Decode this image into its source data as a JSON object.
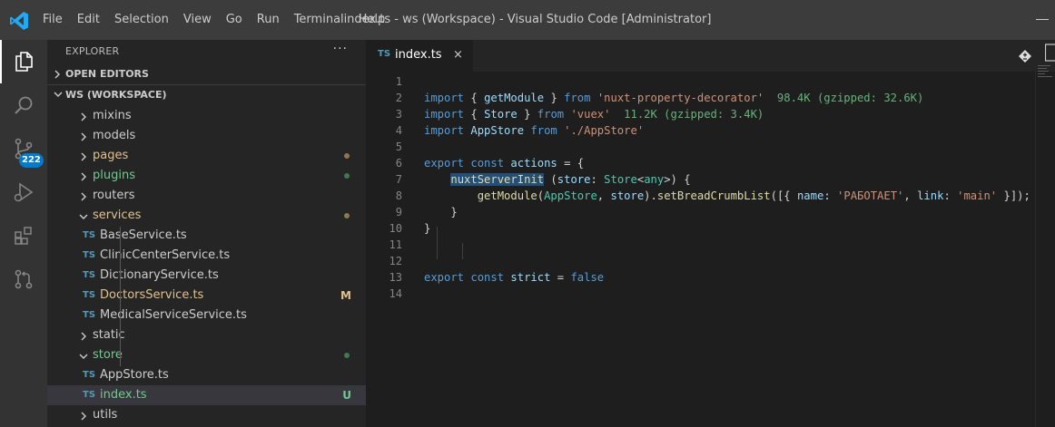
{
  "window": {
    "title": "index.ts - ws (Workspace) - Visual Studio Code [Administrator]",
    "menu": [
      "File",
      "Edit",
      "Selection",
      "View",
      "Go",
      "Run",
      "Terminal",
      "Help"
    ]
  },
  "activity_bar": {
    "items": [
      {
        "icon": "files-icon",
        "active": true
      },
      {
        "icon": "search-icon"
      },
      {
        "icon": "source-control-icon",
        "badge": "222"
      },
      {
        "icon": "run-debug-icon"
      },
      {
        "icon": "extensions-icon"
      },
      {
        "icon": "pull-requests-icon"
      }
    ]
  },
  "explorer": {
    "title": "EXPLORER",
    "more": "···",
    "sections": {
      "open_editors": "OPEN EDITORS",
      "workspace": "WS (WORKSPACE)"
    },
    "tree": [
      {
        "type": "folder",
        "label": "mixins",
        "color": "#cccccc"
      },
      {
        "type": "folder",
        "label": "models",
        "color": "#cccccc"
      },
      {
        "type": "folder",
        "label": "pages",
        "color": "#e2c08d",
        "dot": "#8a7850"
      },
      {
        "type": "folder",
        "label": "plugins",
        "color": "#73c991",
        "dot": "#3f7a4f"
      },
      {
        "type": "folder",
        "label": "routers",
        "color": "#cccccc"
      },
      {
        "type": "folder",
        "label": "services",
        "color": "#e2c08d",
        "dot": "#8a7850",
        "open": true
      },
      {
        "type": "file",
        "label": "BaseService.ts",
        "color": "#cccccc",
        "icon": "TS"
      },
      {
        "type": "file",
        "label": "ClinicCenterService.ts",
        "color": "#cccccc",
        "icon": "TS"
      },
      {
        "type": "file",
        "label": "DictionaryService.ts",
        "color": "#cccccc",
        "icon": "TS"
      },
      {
        "type": "file",
        "label": "DoctorsService.ts",
        "color": "#e2c08d",
        "icon": "TS",
        "status": "M"
      },
      {
        "type": "file",
        "label": "MedicalServiceService.ts",
        "color": "#cccccc",
        "icon": "TS"
      },
      {
        "type": "folder",
        "label": "static",
        "color": "#cccccc"
      },
      {
        "type": "folder",
        "label": "store",
        "color": "#73c991",
        "dot": "#3f7a4f",
        "open": true
      },
      {
        "type": "file",
        "label": "AppStore.ts",
        "color": "#cccccc",
        "icon": "TS"
      },
      {
        "type": "file",
        "label": "index.ts",
        "color": "#73c991",
        "icon": "TS",
        "status": "U",
        "selected": true
      },
      {
        "type": "folder",
        "label": "utils",
        "color": "#cccccc"
      }
    ]
  },
  "editor": {
    "tab": {
      "icon": "TS",
      "label": "index.ts",
      "close": "×"
    },
    "line_numbers": [
      "1",
      "2",
      "3",
      "4",
      "5",
      "6",
      "7",
      "8",
      "9",
      "10",
      "11",
      "12",
      "13",
      "14"
    ],
    "lines": [
      [],
      [
        {
          "t": "import ",
          "c": "kw"
        },
        {
          "t": "{ ",
          "c": ""
        },
        {
          "t": "getModule",
          "c": "var"
        },
        {
          "t": " } ",
          "c": ""
        },
        {
          "t": "from ",
          "c": "kw"
        },
        {
          "t": "'nuxt-property-decorator'",
          "c": "str"
        },
        {
          "t": "  98.4K (gzipped: 32.6K)",
          "c": "size"
        }
      ],
      [
        {
          "t": "import ",
          "c": "kw"
        },
        {
          "t": "{ ",
          "c": ""
        },
        {
          "t": "Store",
          "c": "var"
        },
        {
          "t": " } ",
          "c": ""
        },
        {
          "t": "from ",
          "c": "kw"
        },
        {
          "t": "'vuex'",
          "c": "str"
        },
        {
          "t": "  11.2K (gzipped: 3.4K)",
          "c": "size"
        }
      ],
      [
        {
          "t": "import ",
          "c": "kw"
        },
        {
          "t": "AppStore ",
          "c": "var"
        },
        {
          "t": "from ",
          "c": "kw"
        },
        {
          "t": "'./AppStore'",
          "c": "str"
        }
      ],
      [],
      [
        {
          "t": "export ",
          "c": "kw"
        },
        {
          "t": "const ",
          "c": "kw"
        },
        {
          "t": "actions",
          "c": "var"
        },
        {
          "t": " = {",
          "c": ""
        }
      ],
      [
        {
          "t": "    ",
          "c": ""
        },
        {
          "t": "nuxtServerInit",
          "c": "fn hl"
        },
        {
          "t": " (",
          "c": ""
        },
        {
          "t": "store",
          "c": "var"
        },
        {
          "t": ": ",
          "c": ""
        },
        {
          "t": "Store",
          "c": "type"
        },
        {
          "t": "<",
          "c": ""
        },
        {
          "t": "any",
          "c": "type"
        },
        {
          "t": ">) {",
          "c": ""
        }
      ],
      [
        {
          "t": "        ",
          "c": ""
        },
        {
          "t": "getModule",
          "c": "fn"
        },
        {
          "t": "(",
          "c": ""
        },
        {
          "t": "AppStore",
          "c": "type"
        },
        {
          "t": ", ",
          "c": ""
        },
        {
          "t": "store",
          "c": "var"
        },
        {
          "t": ").",
          "c": ""
        },
        {
          "t": "setBreadCrumbList",
          "c": "fn"
        },
        {
          "t": "([{ ",
          "c": ""
        },
        {
          "t": "name",
          "c": "var"
        },
        {
          "t": ": ",
          "c": ""
        },
        {
          "t": "'РАБОТАЕТ'",
          "c": "str"
        },
        {
          "t": ", ",
          "c": ""
        },
        {
          "t": "link",
          "c": "var"
        },
        {
          "t": ": ",
          "c": ""
        },
        {
          "t": "'main'",
          "c": "str"
        },
        {
          "t": " }]);",
          "c": ""
        }
      ],
      [
        {
          "t": "    }",
          "c": ""
        }
      ],
      [
        {
          "t": "}",
          "c": ""
        }
      ],
      [],
      [],
      [
        {
          "t": "export ",
          "c": "kw"
        },
        {
          "t": "const ",
          "c": "kw"
        },
        {
          "t": "strict",
          "c": "var"
        },
        {
          "t": " = ",
          "c": ""
        },
        {
          "t": "false",
          "c": "kw"
        }
      ],
      []
    ]
  }
}
